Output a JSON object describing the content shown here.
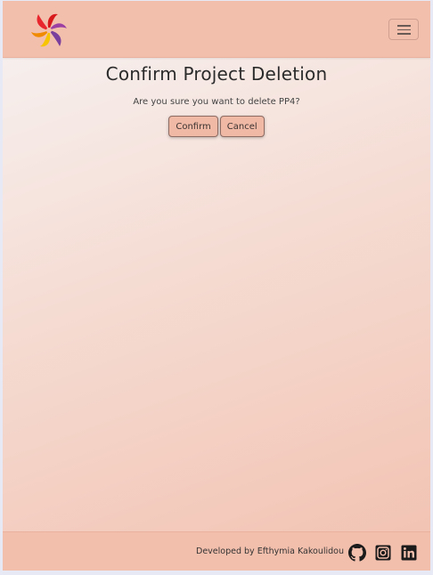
{
  "navbar": {
    "logo_icon": "swirl-logo-icon",
    "toggle_icon": "hamburger-menu-icon"
  },
  "main": {
    "title": "Confirm Project Deletion",
    "prompt": "Are you sure you want to delete PP4?",
    "confirm_label": "Confirm",
    "cancel_label": "Cancel"
  },
  "footer": {
    "credit": "Developed by Efthymia Kakoulidou",
    "links": [
      {
        "icon": "github-icon"
      },
      {
        "icon": "instagram-icon"
      },
      {
        "icon": "linkedin-icon"
      }
    ]
  },
  "colors": {
    "navbar_bg": "#f3bfad",
    "button_bg": "#efb9a6",
    "text_dark": "#2b2b2b"
  }
}
